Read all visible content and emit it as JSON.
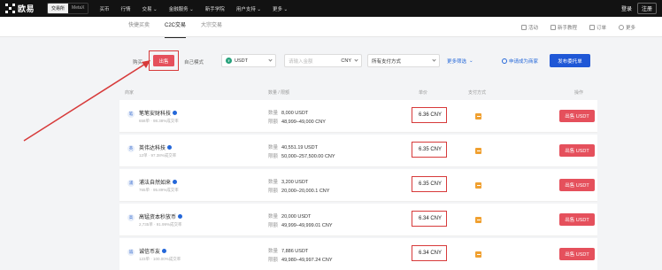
{
  "topnav": {
    "logo_text": "欧易",
    "pills": [
      "交易所",
      "MetaX"
    ],
    "links": [
      "买币",
      "行情",
      "交易 ⌄",
      "金融服务 ⌄",
      "新手学院",
      "用户支持 ⌄",
      "更多 ⌄"
    ],
    "login": "登录",
    "register": "注册"
  },
  "subnav": {
    "tabs": [
      "快捷买卖",
      "C2C交易",
      "大宗交易"
    ],
    "active_tab": "C2C交易",
    "tools": [
      "活动",
      "新手教程",
      "订单",
      "更多"
    ]
  },
  "filter": {
    "buy_label": "购买",
    "sell_label": "出售",
    "mode_label": "自己模式",
    "coin": "USDT",
    "amount_placeholder": "请输入金额",
    "currency": "CNY",
    "payment": "所有支付方式",
    "more_filter": "更多筛选",
    "apply_merchant": "申请成为商家",
    "publish": "发布委托单"
  },
  "table": {
    "headers": [
      "商家",
      "数量 / 限额",
      "单价",
      "支付方式",
      "操作"
    ],
    "rows": [
      {
        "avatar": "笔",
        "name": "笔笔安财科技",
        "stats": "658单 · 98.38%成交率",
        "qty_label": "数量",
        "qty": "8,000 USDT",
        "limit_label": "限额",
        "limit": "48,999–49,000 CNY",
        "price": "6.36 CNY",
        "action": "出售 USDT"
      },
      {
        "avatar": "英",
        "name": "英伟达科技",
        "stats": "12单 · 97.38%成交率",
        "qty_label": "数量",
        "qty": "40,551.19 USDT",
        "limit_label": "限额",
        "limit": "50,000–257,500.00 CNY",
        "price": "6.35 CNY",
        "action": "出售 USDT"
      },
      {
        "avatar": "浦",
        "name": "浦法自然如来",
        "stats": "765单 · 95.89%成交率",
        "qty_label": "数量",
        "qty": "3,200 USDT",
        "limit_label": "限额",
        "limit": "20,000–20,000.1 CNY",
        "price": "6.35 CNY",
        "action": "出售 USDT"
      },
      {
        "avatar": "高",
        "name": "高锰资本秒放币",
        "stats": "2,735单 · 91.99%成交率",
        "qty_label": "数量",
        "qty": "20,000 USDT",
        "limit_label": "限额",
        "limit": "49,999–49,999.01 CNY",
        "price": "6.34 CNY",
        "action": "出售 USDT"
      },
      {
        "avatar": "诚",
        "name": "诚信币友",
        "stats": "123单 · 100.00%成交率",
        "qty_label": "数量",
        "qty": "7,886 USDT",
        "limit_label": "限额",
        "limit": "49,980–49,997.24 CNY",
        "price": "6.34 CNY",
        "action": "出售 USDT"
      }
    ]
  },
  "colors": {
    "sell_red": "#e5505c",
    "primary_blue": "#1f57d6",
    "highlight_box": "#d73a3a",
    "nav_bg": "#121212"
  }
}
